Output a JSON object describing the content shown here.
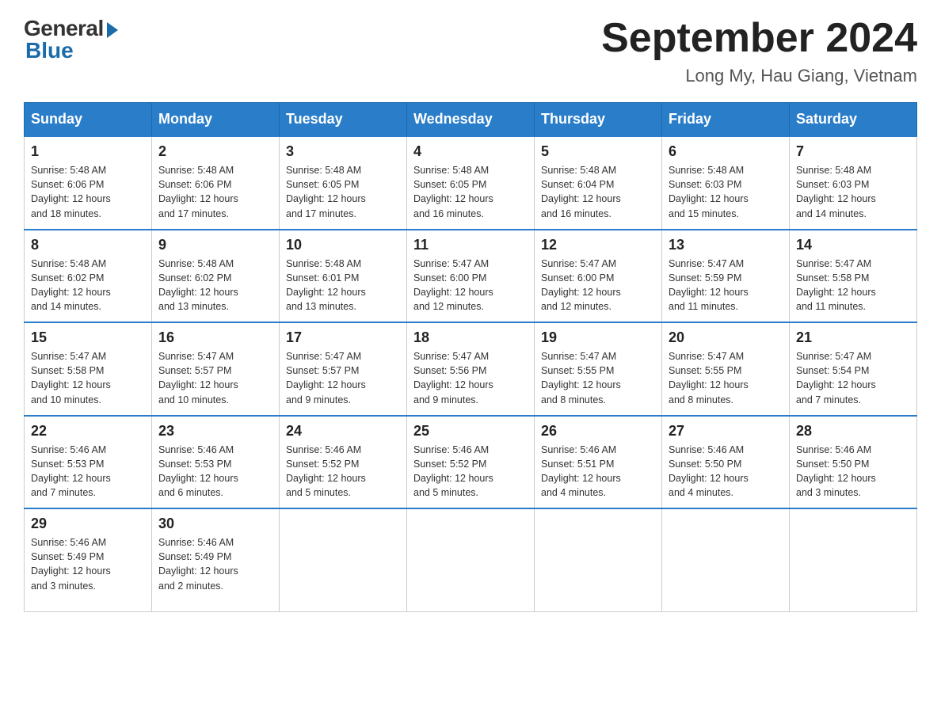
{
  "logo": {
    "general": "General",
    "blue": "Blue"
  },
  "title": "September 2024",
  "subtitle": "Long My, Hau Giang, Vietnam",
  "days_of_week": [
    "Sunday",
    "Monday",
    "Tuesday",
    "Wednesday",
    "Thursday",
    "Friday",
    "Saturday"
  ],
  "weeks": [
    [
      {
        "num": "1",
        "sunrise": "5:48 AM",
        "sunset": "6:06 PM",
        "daylight": "12 hours and 18 minutes."
      },
      {
        "num": "2",
        "sunrise": "5:48 AM",
        "sunset": "6:06 PM",
        "daylight": "12 hours and 17 minutes."
      },
      {
        "num": "3",
        "sunrise": "5:48 AM",
        "sunset": "6:05 PM",
        "daylight": "12 hours and 17 minutes."
      },
      {
        "num": "4",
        "sunrise": "5:48 AM",
        "sunset": "6:05 PM",
        "daylight": "12 hours and 16 minutes."
      },
      {
        "num": "5",
        "sunrise": "5:48 AM",
        "sunset": "6:04 PM",
        "daylight": "12 hours and 16 minutes."
      },
      {
        "num": "6",
        "sunrise": "5:48 AM",
        "sunset": "6:03 PM",
        "daylight": "12 hours and 15 minutes."
      },
      {
        "num": "7",
        "sunrise": "5:48 AM",
        "sunset": "6:03 PM",
        "daylight": "12 hours and 14 minutes."
      }
    ],
    [
      {
        "num": "8",
        "sunrise": "5:48 AM",
        "sunset": "6:02 PM",
        "daylight": "12 hours and 14 minutes."
      },
      {
        "num": "9",
        "sunrise": "5:48 AM",
        "sunset": "6:02 PM",
        "daylight": "12 hours and 13 minutes."
      },
      {
        "num": "10",
        "sunrise": "5:48 AM",
        "sunset": "6:01 PM",
        "daylight": "12 hours and 13 minutes."
      },
      {
        "num": "11",
        "sunrise": "5:47 AM",
        "sunset": "6:00 PM",
        "daylight": "12 hours and 12 minutes."
      },
      {
        "num": "12",
        "sunrise": "5:47 AM",
        "sunset": "6:00 PM",
        "daylight": "12 hours and 12 minutes."
      },
      {
        "num": "13",
        "sunrise": "5:47 AM",
        "sunset": "5:59 PM",
        "daylight": "12 hours and 11 minutes."
      },
      {
        "num": "14",
        "sunrise": "5:47 AM",
        "sunset": "5:58 PM",
        "daylight": "12 hours and 11 minutes."
      }
    ],
    [
      {
        "num": "15",
        "sunrise": "5:47 AM",
        "sunset": "5:58 PM",
        "daylight": "12 hours and 10 minutes."
      },
      {
        "num": "16",
        "sunrise": "5:47 AM",
        "sunset": "5:57 PM",
        "daylight": "12 hours and 10 minutes."
      },
      {
        "num": "17",
        "sunrise": "5:47 AM",
        "sunset": "5:57 PM",
        "daylight": "12 hours and 9 minutes."
      },
      {
        "num": "18",
        "sunrise": "5:47 AM",
        "sunset": "5:56 PM",
        "daylight": "12 hours and 9 minutes."
      },
      {
        "num": "19",
        "sunrise": "5:47 AM",
        "sunset": "5:55 PM",
        "daylight": "12 hours and 8 minutes."
      },
      {
        "num": "20",
        "sunrise": "5:47 AM",
        "sunset": "5:55 PM",
        "daylight": "12 hours and 8 minutes."
      },
      {
        "num": "21",
        "sunrise": "5:47 AM",
        "sunset": "5:54 PM",
        "daylight": "12 hours and 7 minutes."
      }
    ],
    [
      {
        "num": "22",
        "sunrise": "5:46 AM",
        "sunset": "5:53 PM",
        "daylight": "12 hours and 7 minutes."
      },
      {
        "num": "23",
        "sunrise": "5:46 AM",
        "sunset": "5:53 PM",
        "daylight": "12 hours and 6 minutes."
      },
      {
        "num": "24",
        "sunrise": "5:46 AM",
        "sunset": "5:52 PM",
        "daylight": "12 hours and 5 minutes."
      },
      {
        "num": "25",
        "sunrise": "5:46 AM",
        "sunset": "5:52 PM",
        "daylight": "12 hours and 5 minutes."
      },
      {
        "num": "26",
        "sunrise": "5:46 AM",
        "sunset": "5:51 PM",
        "daylight": "12 hours and 4 minutes."
      },
      {
        "num": "27",
        "sunrise": "5:46 AM",
        "sunset": "5:50 PM",
        "daylight": "12 hours and 4 minutes."
      },
      {
        "num": "28",
        "sunrise": "5:46 AM",
        "sunset": "5:50 PM",
        "daylight": "12 hours and 3 minutes."
      }
    ],
    [
      {
        "num": "29",
        "sunrise": "5:46 AM",
        "sunset": "5:49 PM",
        "daylight": "12 hours and 3 minutes."
      },
      {
        "num": "30",
        "sunrise": "5:46 AM",
        "sunset": "5:49 PM",
        "daylight": "12 hours and 2 minutes."
      },
      null,
      null,
      null,
      null,
      null
    ]
  ],
  "labels": {
    "sunrise": "Sunrise:",
    "sunset": "Sunset:",
    "daylight": "Daylight:"
  }
}
